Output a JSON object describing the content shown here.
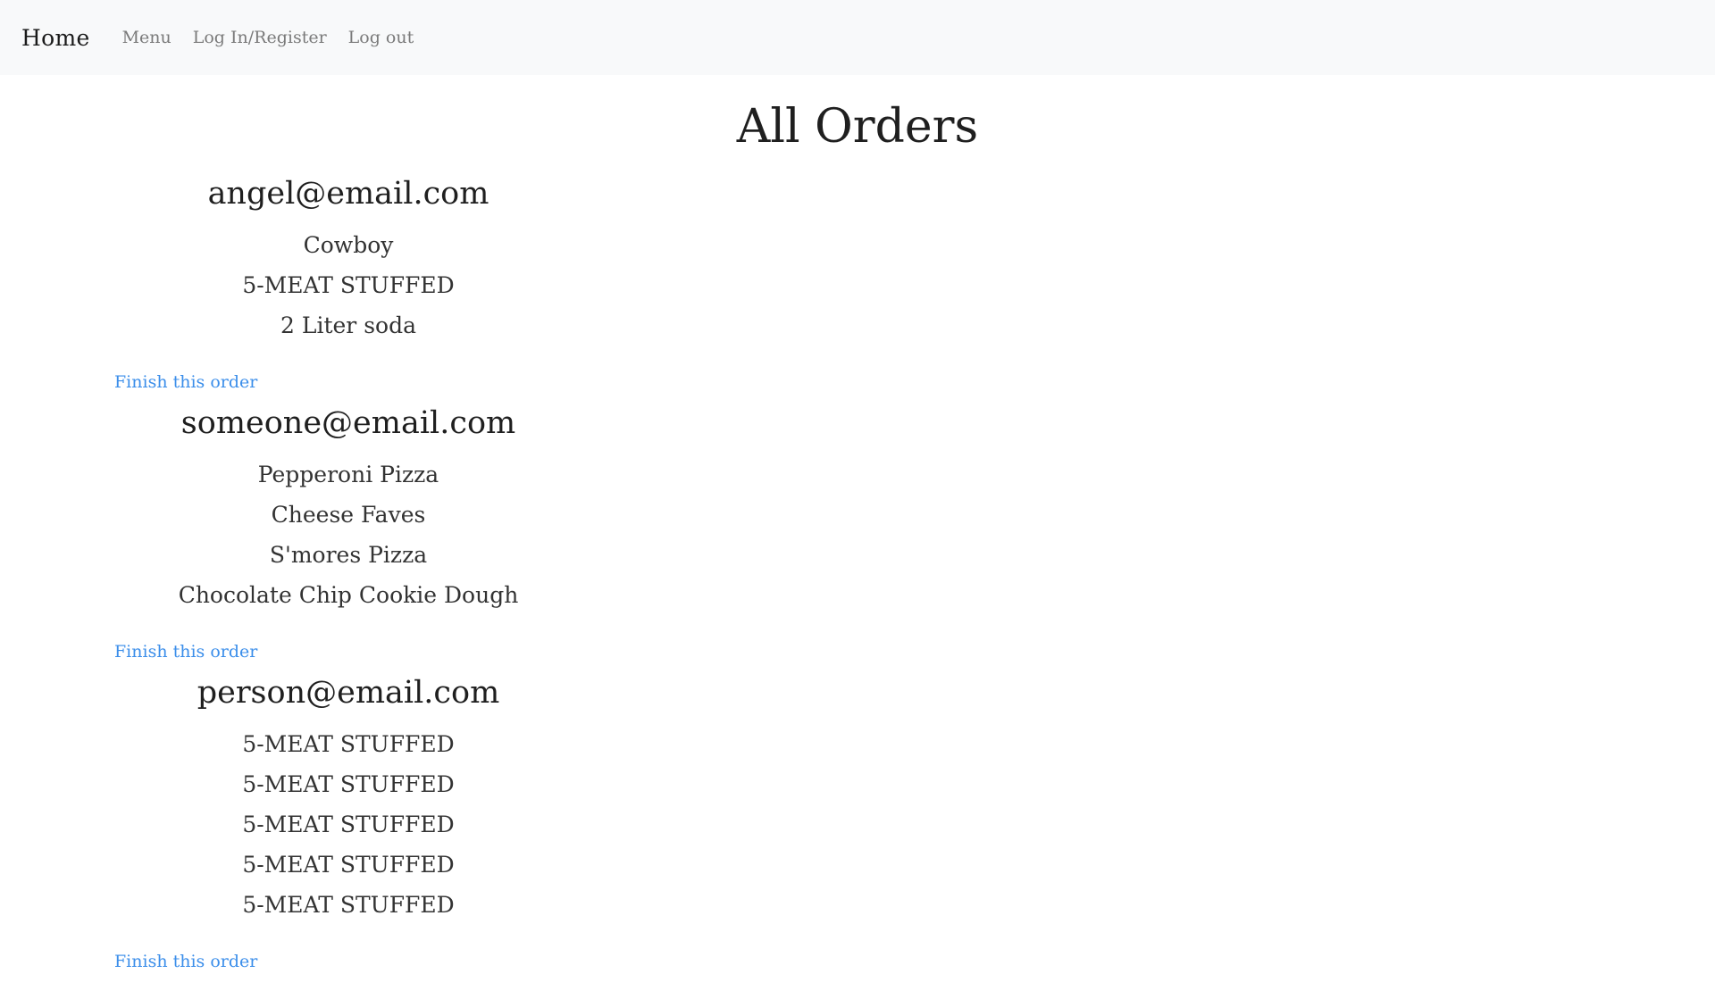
{
  "nav": {
    "brand": "Home",
    "links": [
      "Menu",
      "Log In/Register",
      "Log out"
    ]
  },
  "page": {
    "title": "All Orders"
  },
  "orders": [
    {
      "email": "angel@email.com",
      "items": [
        "Cowboy",
        "5-MEAT STUFFED",
        "2 Liter soda"
      ],
      "action": "Finish this order"
    },
    {
      "email": "someone@email.com",
      "items": [
        "Pepperoni Pizza",
        "Cheese Faves",
        "S'mores Pizza",
        "Chocolate Chip Cookie Dough"
      ],
      "action": "Finish this order"
    },
    {
      "email": "person@email.com",
      "items": [
        "5-MEAT STUFFED",
        "5-MEAT STUFFED",
        "5-MEAT STUFFED",
        "5-MEAT STUFFED",
        "5-MEAT STUFFED"
      ],
      "action": "Finish this order"
    }
  ]
}
